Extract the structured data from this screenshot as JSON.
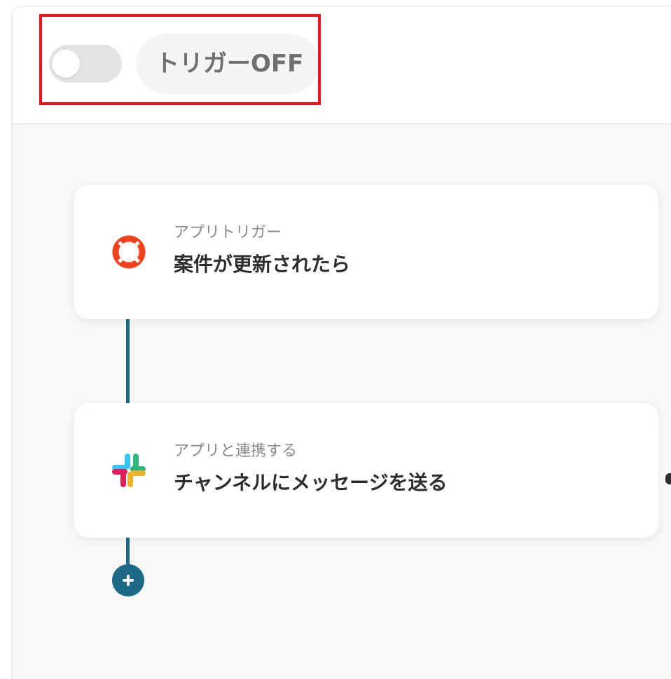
{
  "header": {
    "toggle_state": "off",
    "trigger_status_label": "トリガーOFF"
  },
  "flow": {
    "steps": [
      {
        "subtitle": "アプリトリガー",
        "title": "案件が更新されたら",
        "icon": "lifebuoy-icon"
      },
      {
        "subtitle": "アプリと連携する",
        "title": "チャンネルにメッセージを送る",
        "icon": "slack-icon"
      }
    ],
    "add_step_icon": "plus-icon"
  },
  "colors": {
    "accent": "#1c6a86",
    "highlight": "#e8141b",
    "trigger_app_brand": "#f0421c",
    "slack_blue": "#36c5f0",
    "slack_green": "#2eb67d",
    "slack_yellow": "#ecb22e",
    "slack_red": "#e01e5a"
  }
}
